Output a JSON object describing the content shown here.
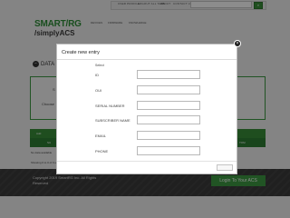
{
  "header": {
    "top_nav": [
      "USER PROFILE",
      "LOGOUT ALL TABS",
      "ABOUT",
      "CONTACT US"
    ],
    "brand_line1": "SMART/RG",
    "brand_line2": "/simplyACS",
    "sub_nav": [
      "DEVICES",
      "FIRMWARE",
      "KNOWLEDGE"
    ]
  },
  "section": {
    "title": "DATA"
  },
  "filter": {
    "label_s": "S",
    "label_choose": "Choose"
  },
  "table": {
    "tab_label": "Add",
    "col_label": "SU",
    "action_label": "TOM",
    "no_data": "No data available",
    "showing": "Showing 0 to 0 of 0 entries"
  },
  "footer": {
    "copyright_line1": "Copyright 2019 SmartRG Inc. All Rights",
    "copyright_line2": "Reserved",
    "login_label": "Login To Your ACS"
  },
  "modal": {
    "title": "Create new entry",
    "select_label": "Select",
    "fields": [
      {
        "label": "ID",
        "value": ""
      },
      {
        "label": "OUI",
        "value": ""
      },
      {
        "label": "SERIAL NUMBER",
        "value": ""
      },
      {
        "label": "SUBSCRIBER NAME",
        "value": ""
      },
      {
        "label": "EMAIL",
        "value": ""
      },
      {
        "label": "PHONE",
        "value": ""
      }
    ],
    "close_icon": "close-icon",
    "submit_label": ""
  },
  "colors": {
    "brand_green": "#2f8f38",
    "overlay": "rgba(0,0,0,0.45)",
    "footer_bg": "#3b3b3b"
  }
}
